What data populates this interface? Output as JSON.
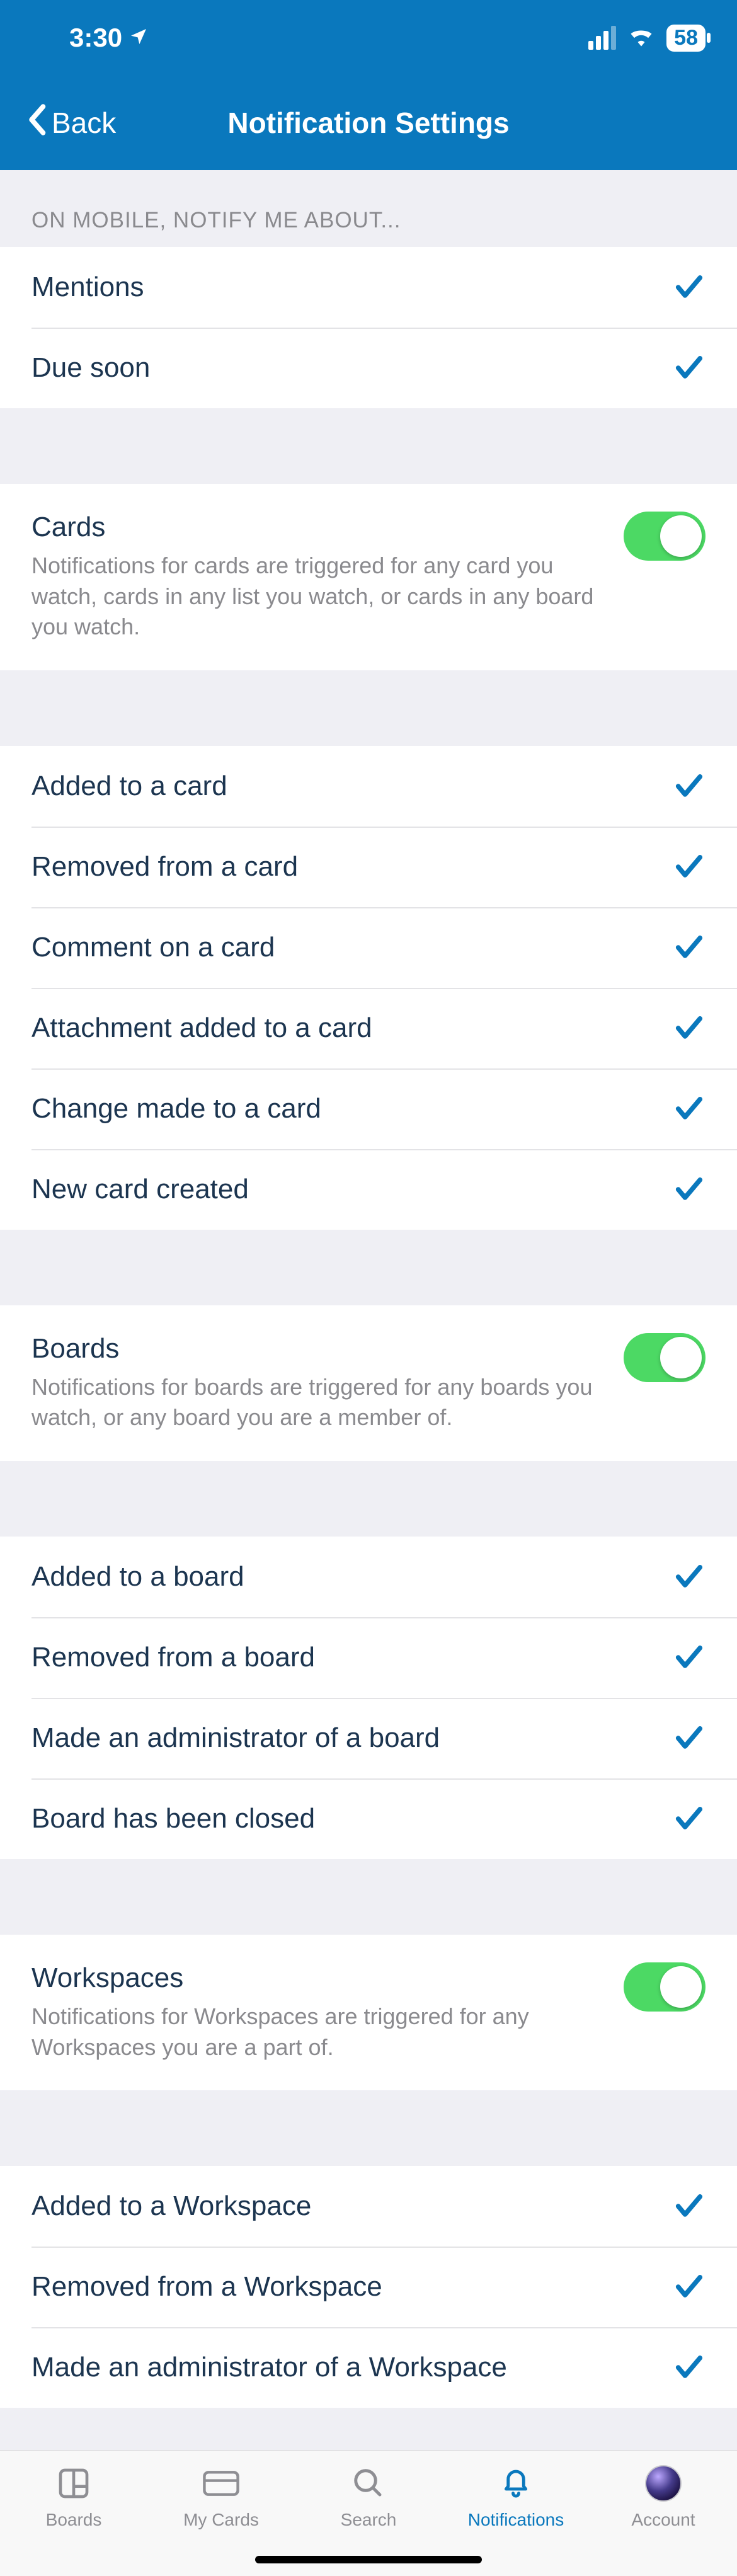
{
  "status": {
    "time": "3:30",
    "battery": "58"
  },
  "nav": {
    "back": "Back",
    "title": "Notification Settings"
  },
  "sections": {
    "top": {
      "header": "ON MOBILE, NOTIFY ME ABOUT...",
      "rows": [
        {
          "label": "Mentions"
        },
        {
          "label": "Due soon"
        }
      ]
    },
    "cards": {
      "title": "Cards",
      "desc": "Notifications for cards are triggered for any card you watch, cards in any list you watch, or cards in any board you watch.",
      "rows": [
        {
          "label": "Added to a card"
        },
        {
          "label": "Removed from a card"
        },
        {
          "label": "Comment on a card"
        },
        {
          "label": "Attachment added to a card"
        },
        {
          "label": "Change made to a card"
        },
        {
          "label": "New card created"
        }
      ]
    },
    "boards": {
      "title": "Boards",
      "desc": "Notifications for boards are triggered for any boards you watch, or any board you are a member of.",
      "rows": [
        {
          "label": "Added to a board"
        },
        {
          "label": "Removed from a board"
        },
        {
          "label": "Made an administrator of a board"
        },
        {
          "label": "Board has been closed"
        }
      ]
    },
    "workspaces": {
      "title": "Workspaces",
      "desc": "Notifications for Workspaces are triggered for any Workspaces you are a part of.",
      "rows": [
        {
          "label": "Added to a Workspace"
        },
        {
          "label": "Removed from a Workspace"
        },
        {
          "label": "Made an administrator of a Workspace"
        }
      ]
    }
  },
  "tabs": {
    "boards": "Boards",
    "mycards": "My Cards",
    "search": "Search",
    "notifications": "Notifications",
    "account": "Account"
  }
}
